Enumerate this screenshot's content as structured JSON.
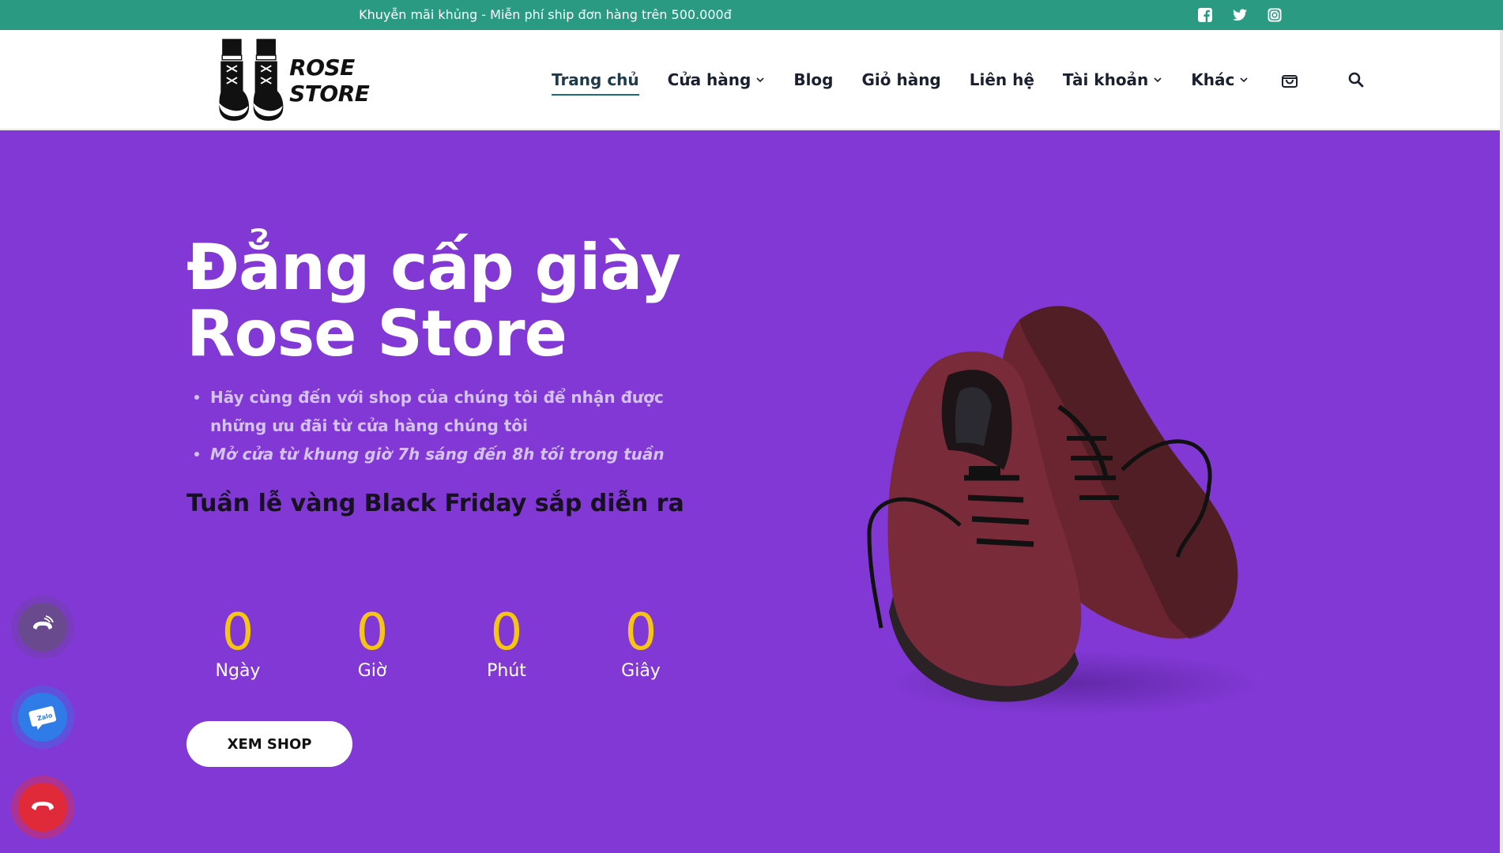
{
  "topbar": {
    "promo_text": "Khuyễn mãi khủng - Miễn phí ship đơn hàng trên 500.000đ",
    "social_icons": [
      "facebook-icon",
      "twitter-icon",
      "instagram-icon"
    ],
    "background": "#2a9a83"
  },
  "header": {
    "logo_text": "ROSE STORE",
    "nav": [
      {
        "label": "Trang chủ",
        "active": true,
        "dropdown": false
      },
      {
        "label": "Cửa hàng",
        "active": false,
        "dropdown": true
      },
      {
        "label": "Blog",
        "active": false,
        "dropdown": false
      },
      {
        "label": "Giỏ hàng",
        "active": false,
        "dropdown": false
      },
      {
        "label": "Liên hệ",
        "active": false,
        "dropdown": false
      },
      {
        "label": "Tài khoản",
        "active": false,
        "dropdown": true
      },
      {
        "label": "Khác",
        "active": false,
        "dropdown": true
      }
    ],
    "icons": [
      "cart-icon",
      "search-icon"
    ]
  },
  "hero": {
    "background": "#8138d4",
    "title_line1": "Đẳng cấp giày",
    "title_line2": "Rose Store",
    "bullets": [
      "Hãy cùng đến với shop của chúng tôi để nhận được những ưu đãi từ cửa hàng chúng tôi",
      "Mở cửa từ khung giờ 7h sáng đến 8h tối trong tuần"
    ],
    "subtitle": "Tuần lễ vàng Black Friday sắp diễn ra",
    "countdown": [
      {
        "value": "0",
        "label": "Ngày"
      },
      {
        "value": "0",
        "label": "Giờ"
      },
      {
        "value": "0",
        "label": "Phút"
      },
      {
        "value": "0",
        "label": "Giây"
      }
    ],
    "cta_label": "XEM SHOP",
    "countdown_color": "#f6c514"
  },
  "floating": {
    "buttons": [
      "phone-ring-icon",
      "zalo-icon",
      "phone-call-icon"
    ],
    "zalo_label": "Zalo"
  }
}
